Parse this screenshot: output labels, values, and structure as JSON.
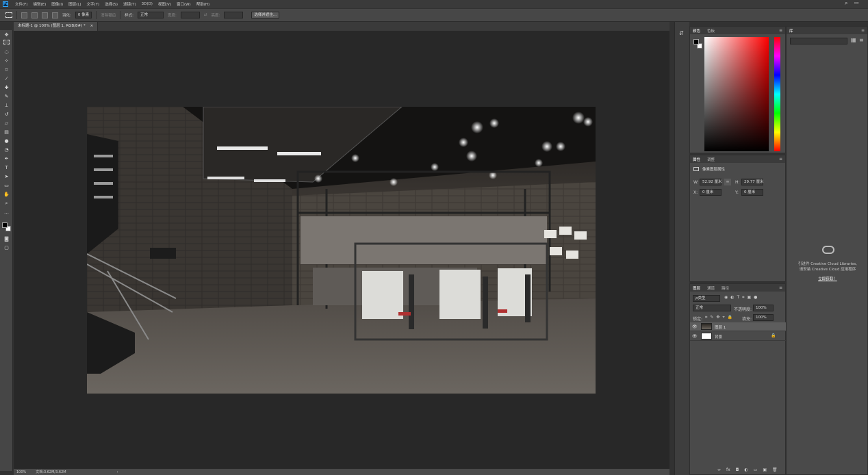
{
  "app": {
    "logo_text": "Ps"
  },
  "menu": [
    "文件(F)",
    "编辑(E)",
    "图像(I)",
    "图层(L)",
    "文字(Y)",
    "选择(S)",
    "滤镜(T)",
    "3D(D)",
    "视图(V)",
    "窗口(W)",
    "帮助(H)"
  ],
  "options": {
    "feather_label": "羽化:",
    "feather_value": "0 像素",
    "antialias": "消除锯齿",
    "style_label": "样式:",
    "style_value": "正常",
    "width_label": "宽度:",
    "height_label": "高度:",
    "select_mask_button": "选择并遮住..."
  },
  "document_tab": {
    "title": "未标题-1 @ 100% (图层 1, RGB/8#) *",
    "close": "×"
  },
  "status": {
    "zoom": "100%",
    "doc_info": "文档:3.62M/3.62M",
    "arrow": "›"
  },
  "color_panel": {
    "tabs": [
      "颜色",
      "色板"
    ],
    "menu": "≡"
  },
  "properties_panel": {
    "tabs": [
      "属性",
      "调整"
    ],
    "title": "像素图层属性",
    "w_label": "W:",
    "w_value": "52.92 厘米",
    "h_label": "H:",
    "h_value": "29.77 厘米",
    "x_label": "X:",
    "x_value": "0 厘米",
    "y_label": "Y:",
    "y_value": "0 厘米",
    "link": "∞"
  },
  "layers_panel": {
    "tabs": [
      "图层",
      "通道",
      "路径"
    ],
    "filter_kind": "ρ类型",
    "blend_mode": "正常",
    "opacity_label": "不透明度:",
    "opacity_value": "100%",
    "lock_label": "锁定:",
    "fill_label": "填充:",
    "fill_value": "100%",
    "layers": [
      {
        "name": "图层 1",
        "selected": true,
        "eye": "👁"
      },
      {
        "name": "背景",
        "selected": false,
        "eye": "👁",
        "lock": "🔒"
      }
    ],
    "bottom_icons": [
      "link-icon",
      "fx-icon",
      "mask-icon",
      "adjustment-icon",
      "group-icon",
      "new-layer-icon",
      "trash-icon"
    ],
    "bottom_glyphs": [
      "∞",
      "fx",
      "◘",
      "◐",
      "▭",
      "▣",
      "🗑"
    ]
  },
  "libraries_panel": {
    "tab": "库",
    "message_line1": "引进件 Creative Cloud Libraries,",
    "message_line2": "请安装 Creative Cloud 应用程序",
    "link": "立即获取！"
  },
  "colors": {
    "accent": "#31a8ff",
    "fg": "#000000",
    "bg": "#ffffff"
  }
}
